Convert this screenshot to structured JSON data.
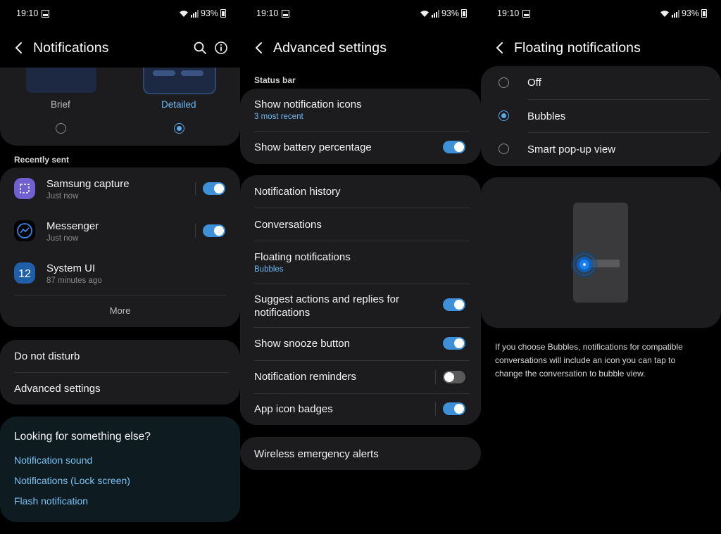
{
  "status_bar": {
    "time": "19:10",
    "battery": "93%"
  },
  "screen1": {
    "title": "Notifications",
    "style_options": [
      {
        "label": "Brief",
        "selected": false
      },
      {
        "label": "Detailed",
        "selected": true
      }
    ],
    "recently_sent_label": "Recently sent",
    "apps": [
      {
        "name": "Samsung capture",
        "time": "Just now",
        "enabled": true
      },
      {
        "name": "Messenger",
        "time": "Just now",
        "enabled": true
      },
      {
        "name": "System UI",
        "time": "87 minutes ago"
      }
    ],
    "more_label": "More",
    "menu": [
      "Do not disturb",
      "Advanced settings"
    ],
    "looking_title": "Looking for something else?",
    "looking_links": [
      "Notification sound",
      "Notifications (Lock screen)",
      "Flash notification"
    ]
  },
  "screen2": {
    "title": "Advanced settings",
    "status_bar_label": "Status bar",
    "show_icons": {
      "title": "Show notification icons",
      "sub": "3 most recent"
    },
    "battery_pct": {
      "title": "Show battery percentage",
      "enabled": true
    },
    "history": "Notification history",
    "conversations": "Conversations",
    "floating": {
      "title": "Floating notifications",
      "sub": "Bubbles"
    },
    "suggest": {
      "title_line1": "Suggest actions and replies for",
      "title_line2": "notifications",
      "enabled": true
    },
    "snooze": {
      "title": "Show snooze button",
      "enabled": true
    },
    "reminders": {
      "title": "Notification reminders",
      "enabled": false
    },
    "badges": {
      "title": "App icon badges",
      "enabled": true
    },
    "emergency": "Wireless emergency alerts"
  },
  "screen3": {
    "title": "Floating notifications",
    "options": [
      {
        "label": "Off",
        "selected": false
      },
      {
        "label": "Bubbles",
        "selected": true
      },
      {
        "label": "Smart pop-up view",
        "selected": false
      }
    ],
    "description_lines": [
      "If you choose Bubbles, notifications for compatible",
      "conversations will include an icon you can tap to",
      "change the conversation to bubble view."
    ]
  },
  "colors": {
    "accent": "#3e91d8",
    "link": "#79c3f5",
    "card": "#1c1c1e",
    "background": "#000000"
  },
  "icons": {
    "back": "chevron-left-icon",
    "search": "search-icon",
    "info": "info-icon"
  }
}
